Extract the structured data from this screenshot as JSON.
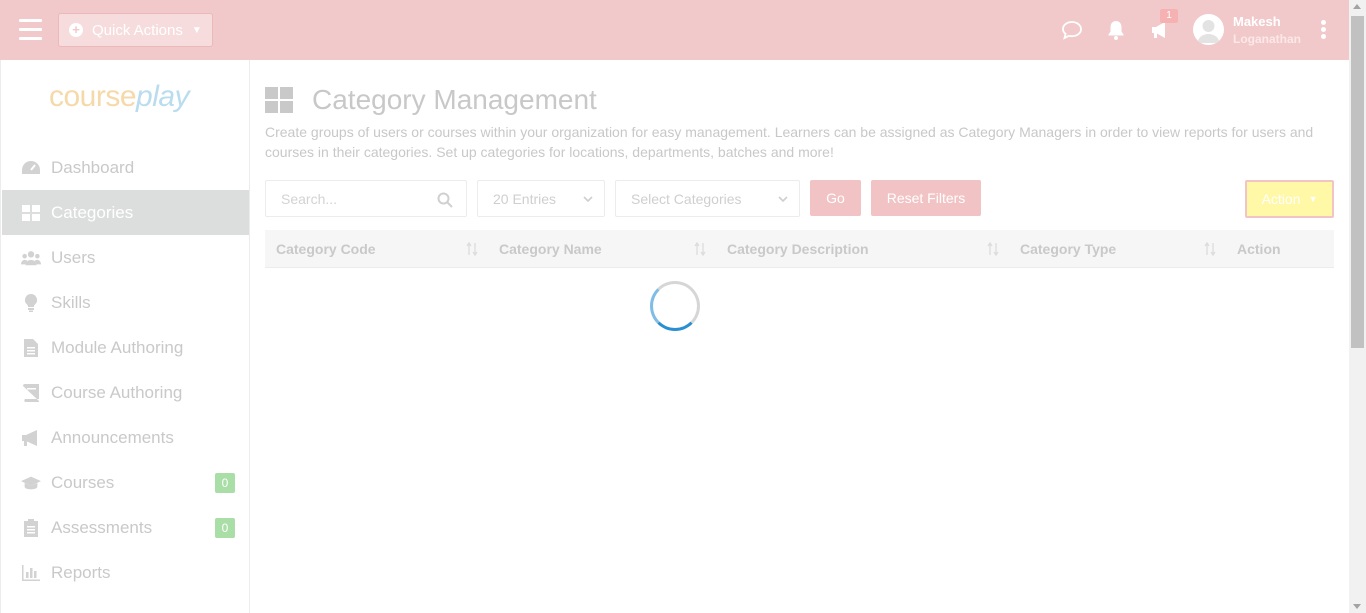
{
  "topbar": {
    "quick_actions_label": "Quick Actions",
    "notification_count": "1",
    "user_first_name": "Makesh",
    "user_last_name": "Loganathan"
  },
  "logo": {
    "part1": "course",
    "part2": "play"
  },
  "sidebar": {
    "items": [
      {
        "label": "Dashboard",
        "icon": "dashboard-icon"
      },
      {
        "label": "Categories",
        "icon": "grid-icon",
        "active": true
      },
      {
        "label": "Users",
        "icon": "users-icon"
      },
      {
        "label": "Skills",
        "icon": "lightbulb-icon"
      },
      {
        "label": "Module Authoring",
        "icon": "file-icon"
      },
      {
        "label": "Course Authoring",
        "icon": "book-icon"
      },
      {
        "label": "Announcements",
        "icon": "megaphone-icon"
      },
      {
        "label": "Courses",
        "icon": "graduation-cap-icon",
        "count": "0"
      },
      {
        "label": "Assessments",
        "icon": "clipboard-icon",
        "count": "0"
      },
      {
        "label": "Reports",
        "icon": "bar-chart-icon"
      }
    ]
  },
  "page": {
    "title": "Category Management",
    "description": "Create groups of users or courses within your organization for easy management. Learners can be assigned as Category Managers in order to view reports for users and courses in their categories. Set up categories for locations, departments, batches and more!"
  },
  "filters": {
    "search_placeholder": "Search...",
    "entries_value": "20 Entries",
    "categories_value": "Select Categories",
    "go_label": "Go",
    "reset_label": "Reset Filters",
    "action_label": "Action"
  },
  "table": {
    "columns": [
      "Category Code",
      "Category Name",
      "Category Description",
      "Category Type",
      "Action"
    ]
  },
  "colors": {
    "topbar": "#f1c9ca",
    "accent_button": "#f1c3c4",
    "action_button": "#fff8a6",
    "count_badge": "#a9dfa7"
  }
}
